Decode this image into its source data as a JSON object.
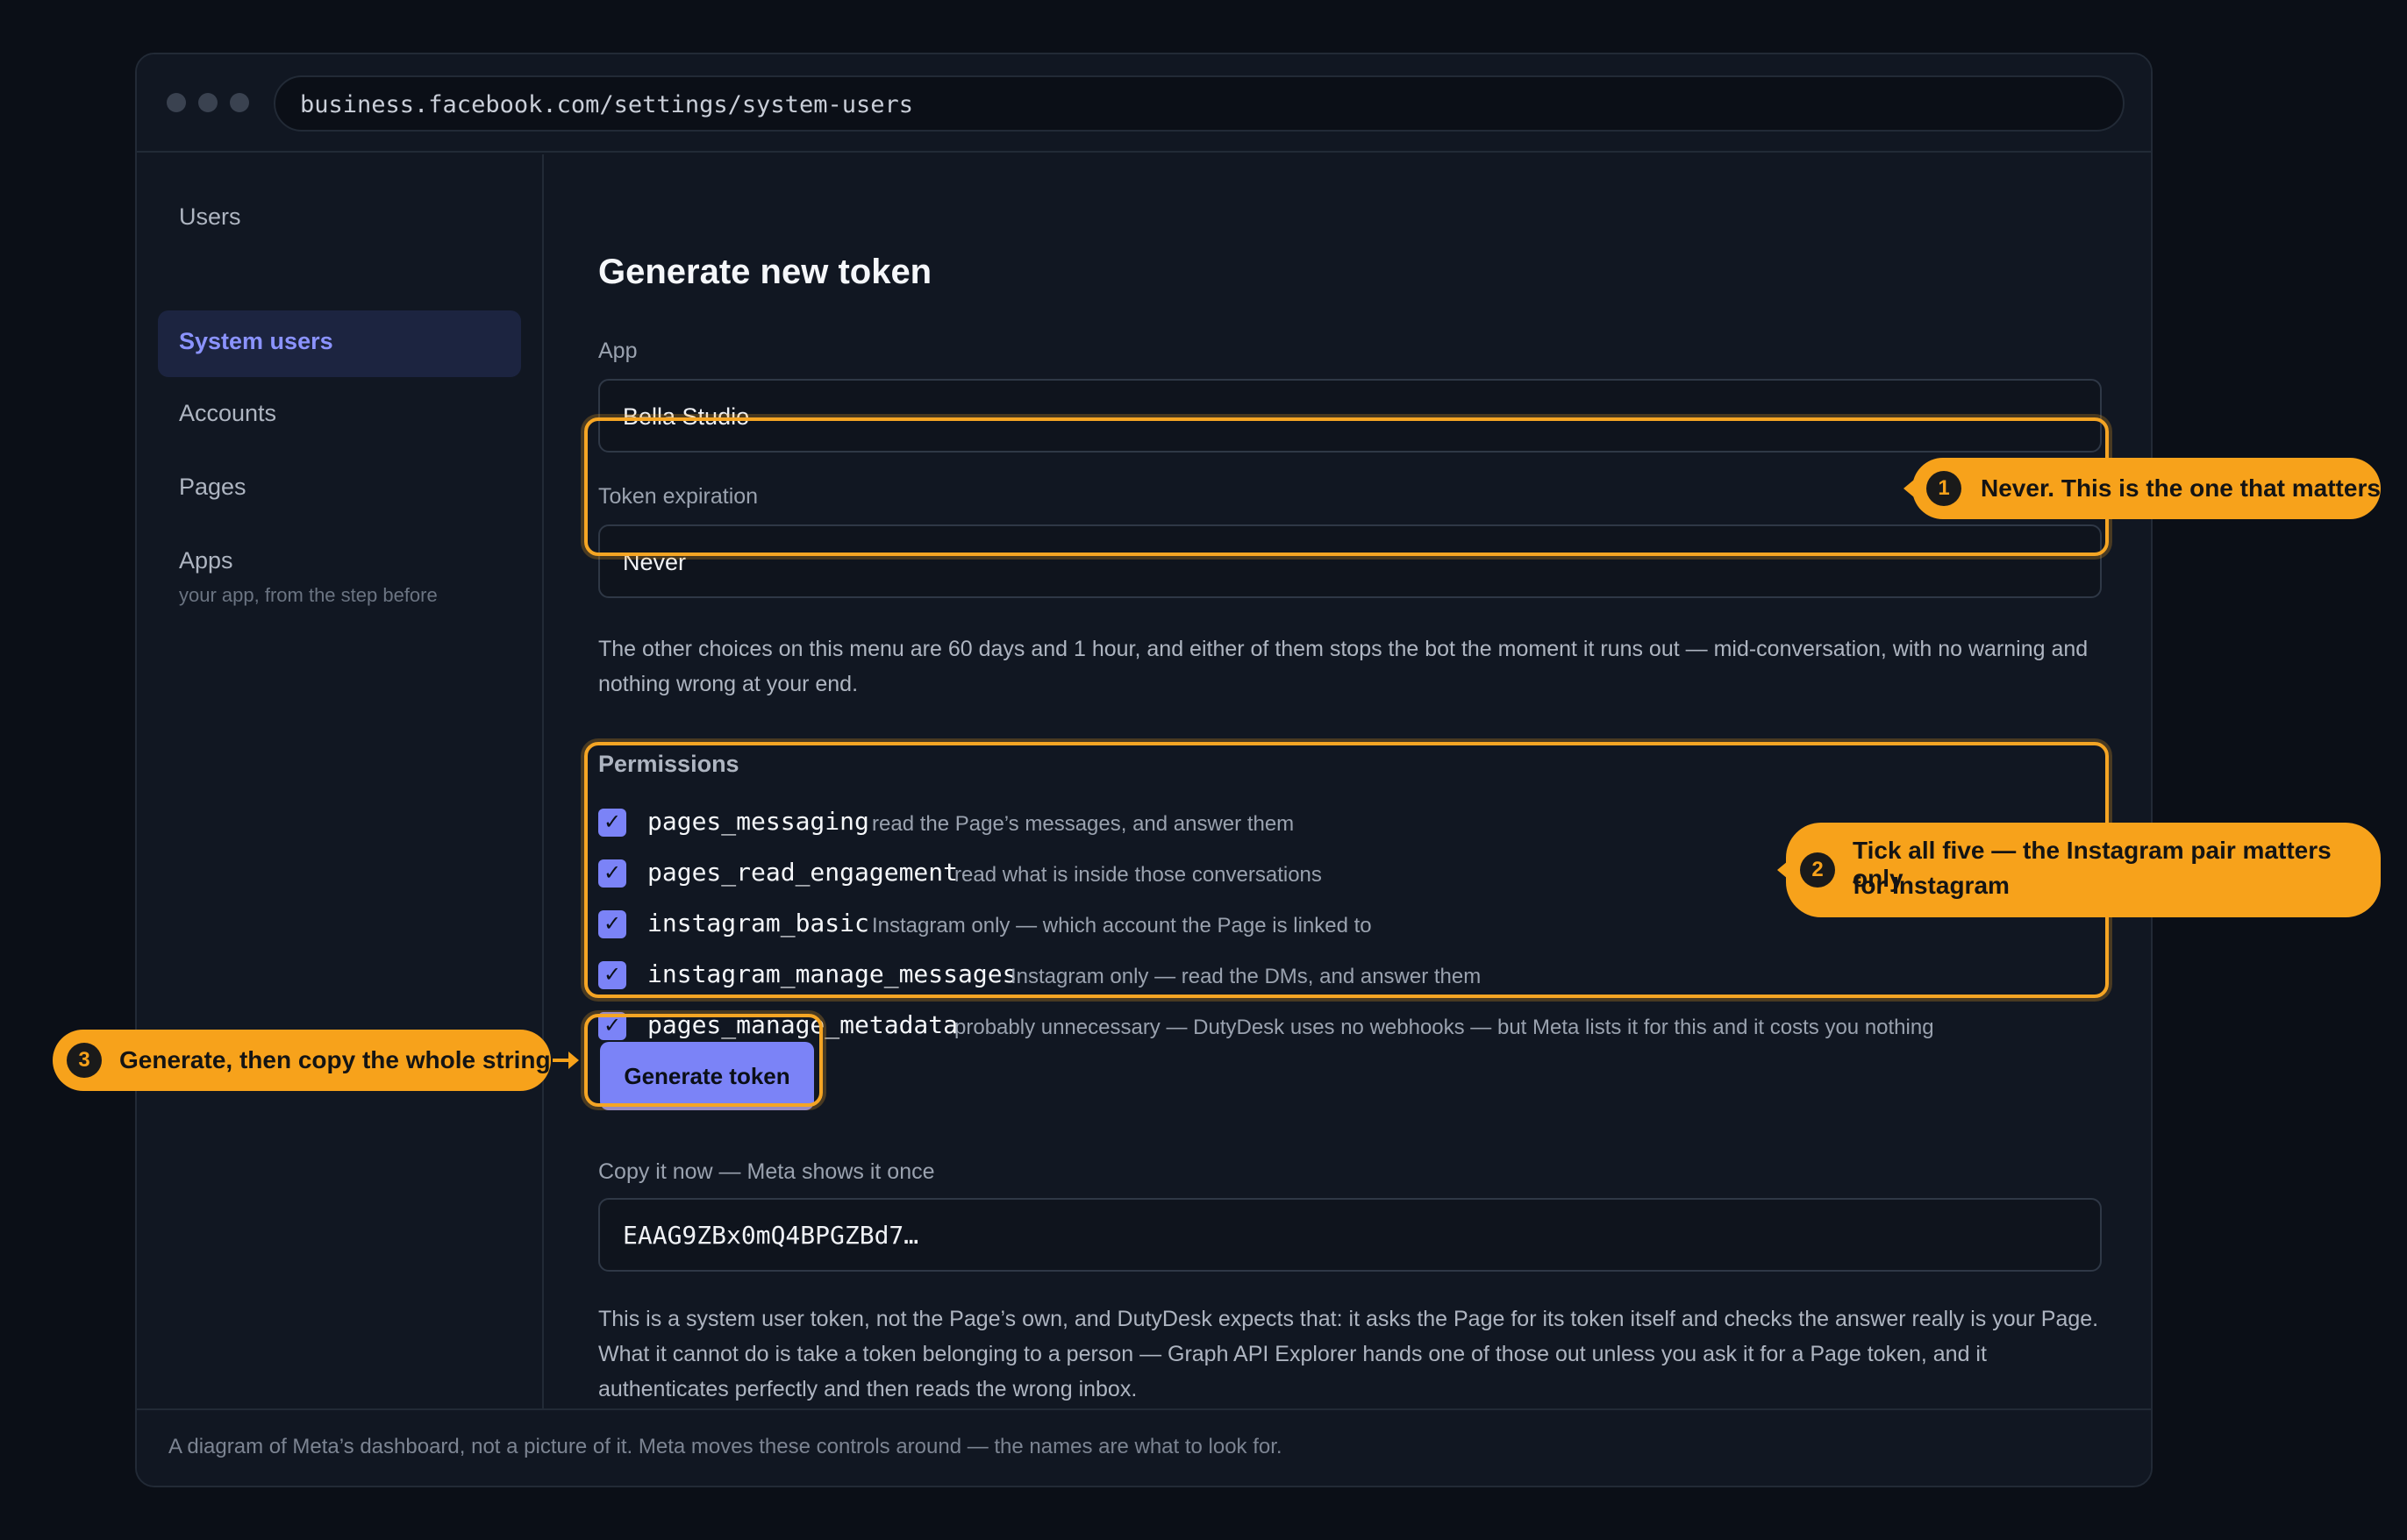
{
  "browser": {
    "url": "business.facebook.com/settings/system-users"
  },
  "sidebar": {
    "items": [
      {
        "label": "Users"
      },
      {
        "label": "System users",
        "active": true
      },
      {
        "label": "Accounts"
      },
      {
        "label": "Pages"
      },
      {
        "label": "Apps",
        "sublabel": "your app, from the step before"
      }
    ]
  },
  "main": {
    "title": "Generate new token",
    "app_label": "App",
    "app_value": "Bella Studio",
    "expiration_label": "Token expiration",
    "expiration_value": "Never",
    "expiration_note": "The other choices on this menu are 60 days and 1 hour, and either of them stops the bot the moment it runs out — mid-conversation, with no warning and nothing wrong at your end.",
    "permissions_title": "Permissions",
    "permissions": [
      {
        "name": "pages_messaging",
        "desc": "read the Page’s messages, and answer them",
        "checked": true
      },
      {
        "name": "pages_read_engagement",
        "desc": "read what is inside those conversations",
        "checked": true
      },
      {
        "name": "instagram_basic",
        "desc": "Instagram only — which account the Page is linked to",
        "checked": true
      },
      {
        "name": "instagram_manage_messages",
        "desc": "Instagram only — read the DMs, and answer them",
        "checked": true
      },
      {
        "name": "pages_manage_metadata",
        "desc": "probably unnecessary — DutyDesk uses no webhooks — but Meta lists it for this and it costs you nothing",
        "checked": true
      }
    ],
    "generate_button": "Generate token",
    "copy_label": "Copy it now — Meta shows it once",
    "token_value": "EAAG9ZBx0mQ4BPGZBd7…",
    "token_note": "This is a system user token, not the Page’s own, and DutyDesk expects that: it asks the Page for its token itself and checks the answer really is your Page. What it cannot do is take a token belonging to a person — Graph API Explorer hands one of those out unless you ask it for a Page token, and it authenticates perfectly and then reads the wrong inbox."
  },
  "footer": {
    "text": "A diagram of Meta’s dashboard, not a picture of it. Meta moves these controls around — the names are what to look for."
  },
  "callouts": [
    {
      "num": "1",
      "text": "Never. This is the one that matters"
    },
    {
      "num": "2",
      "text_line1": "Tick all five — the Instagram pair matters only",
      "text_line2": "for Instagram"
    },
    {
      "num": "3",
      "text": "Generate, then copy the whole string"
    }
  ],
  "colors": {
    "accent": "#7b83f7",
    "highlight": "#f7a21b",
    "background": "#0b0f17"
  },
  "icons": {
    "checkbox": "check-icon"
  }
}
